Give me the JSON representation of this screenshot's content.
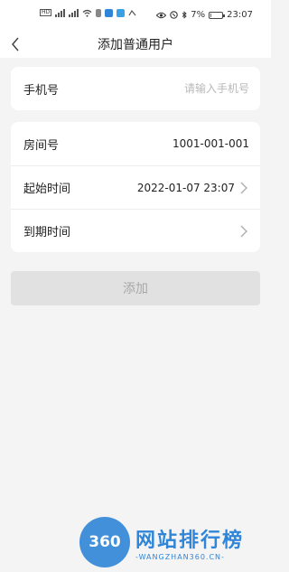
{
  "status_bar": {
    "time": "23:07",
    "battery": "7%",
    "battery_level": 0.07
  },
  "nav": {
    "title": "添加普通用户"
  },
  "form": {
    "phone": {
      "label": "手机号",
      "value": "",
      "placeholder": "请输入手机号"
    },
    "room": {
      "label": "房间号",
      "value": "1001-001-001"
    },
    "start_time": {
      "label": "起始时间",
      "value": "2022-01-07 23:07"
    },
    "end_time": {
      "label": "到期时间",
      "value": ""
    }
  },
  "actions": {
    "add_label": "添加"
  },
  "watermark": {
    "logo_text": "360",
    "title": "网站排行榜",
    "url": "-WANGZHAN360.CN-"
  },
  "colors": {
    "accent": "#2f86d8",
    "background": "#f4f4f4",
    "disabled_button": "#e1e1e1"
  }
}
